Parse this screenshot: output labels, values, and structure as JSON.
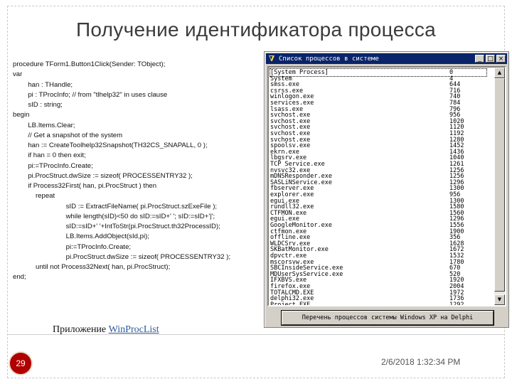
{
  "slide": {
    "title": "Получение идентификатора процесса",
    "code_lines": [
      "procedure TForm1.Button1Click(Sender: TObject);",
      "var",
      "        han : THandle;",
      "        pi : TProcInfo; // from \"tlhelp32\" in uses clause",
      "        sID : string;",
      "begin",
      "        LB.Items.Clear;",
      "        // Get a snapshot of the system",
      "        han := CreateToolhelp32Snapshot(TH32CS_SNAPALL, 0 );",
      "        if han = 0 then exit;",
      "        pi:=TProcInfo.Create;",
      "        pi.ProcStruct.dwSize := sizeof( PROCESSENTRY32 );",
      "        if Process32First( han, pi.ProcStruct ) then",
      "            repeat",
      "                            sID := ExtractFileName( pi.ProcStruct.szExeFile );",
      "                            while length(sID)<50 do sID:=sID+' '; sID:=sID+'|';",
      "                            sID:=sID+' '+IntToStr(pi.ProcStruct.th32ProcessID);",
      "                            LB.Items.AddObject(sId,pi);",
      "                            pi:=TProcInfo.Create;",
      "                            pi.ProcStruct.dwSize := sizeof( PROCESSENTRY32 );",
      "            until not Process32Next( han, pi.ProcStruct);",
      "end;"
    ],
    "caption_prefix": "Приложение ",
    "caption_link": "WinProcList",
    "page_number": "29",
    "date": "2/6/2018 1:32:34 PM"
  },
  "app_window": {
    "title": "Список процессов в системе",
    "minimize": "_",
    "maximize": "□",
    "close": "×",
    "processes": [
      {
        "name": "[System Process]",
        "pid": "0"
      },
      {
        "name": "System",
        "pid": "4"
      },
      {
        "name": "smss.exe",
        "pid": "644"
      },
      {
        "name": "csrss.exe",
        "pid": "716"
      },
      {
        "name": "winlogon.exe",
        "pid": "740"
      },
      {
        "name": "services.exe",
        "pid": "784"
      },
      {
        "name": "lsass.exe",
        "pid": "796"
      },
      {
        "name": "svchost.exe",
        "pid": "956"
      },
      {
        "name": "svchost.exe",
        "pid": "1020"
      },
      {
        "name": "svchost.exe",
        "pid": "1120"
      },
      {
        "name": "svchost.exe",
        "pid": "1192"
      },
      {
        "name": "svchost.exe",
        "pid": "1280"
      },
      {
        "name": "spoolsv.exe",
        "pid": "1452"
      },
      {
        "name": "ekrn.exe",
        "pid": "1436"
      },
      {
        "name": "lbgsrv.exe",
        "pid": "1040"
      },
      {
        "name": "TCP Service.exe",
        "pid": "1261"
      },
      {
        "name": "nvsvc32.exe",
        "pid": "1256"
      },
      {
        "name": "mDNSResponder.exe",
        "pid": "1256"
      },
      {
        "name": "SASLiNService.exe",
        "pid": "1296"
      },
      {
        "name": "fbserver.exe",
        "pid": "1300"
      },
      {
        "name": "explorer.exe",
        "pid": "956"
      },
      {
        "name": "egui.exe",
        "pid": "1300"
      },
      {
        "name": "rundll32.exe",
        "pid": "1580"
      },
      {
        "name": "CTFMON.exe",
        "pid": "1560"
      },
      {
        "name": "egui.exe",
        "pid": "1296"
      },
      {
        "name": "GoogleMonitor.exe",
        "pid": "1556"
      },
      {
        "name": "ctfmon.exe",
        "pid": "1900"
      },
      {
        "name": "offline.exe",
        "pid": "356"
      },
      {
        "name": "WLDCSrv.exe",
        "pid": "1628"
      },
      {
        "name": "SKBatMonitor.exe",
        "pid": "1672"
      },
      {
        "name": "dpvctr.exe",
        "pid": "1532"
      },
      {
        "name": "mscorsvw.exe",
        "pid": "1780"
      },
      {
        "name": "SBCInsideService.exe",
        "pid": "670"
      },
      {
        "name": "MDUserSysService.exe",
        "pid": "520"
      },
      {
        "name": "IFXBVS.exe",
        "pid": "1920"
      },
      {
        "name": "firefox.exe",
        "pid": "2004"
      },
      {
        "name": "TOTALCMD.EXE",
        "pid": "1972"
      },
      {
        "name": "delphi32.exe",
        "pid": "1736"
      },
      {
        "name": "Project.EXE",
        "pid": "1292"
      }
    ],
    "button_label": "Перечень процессов системы  Windows XP на Delphi"
  }
}
